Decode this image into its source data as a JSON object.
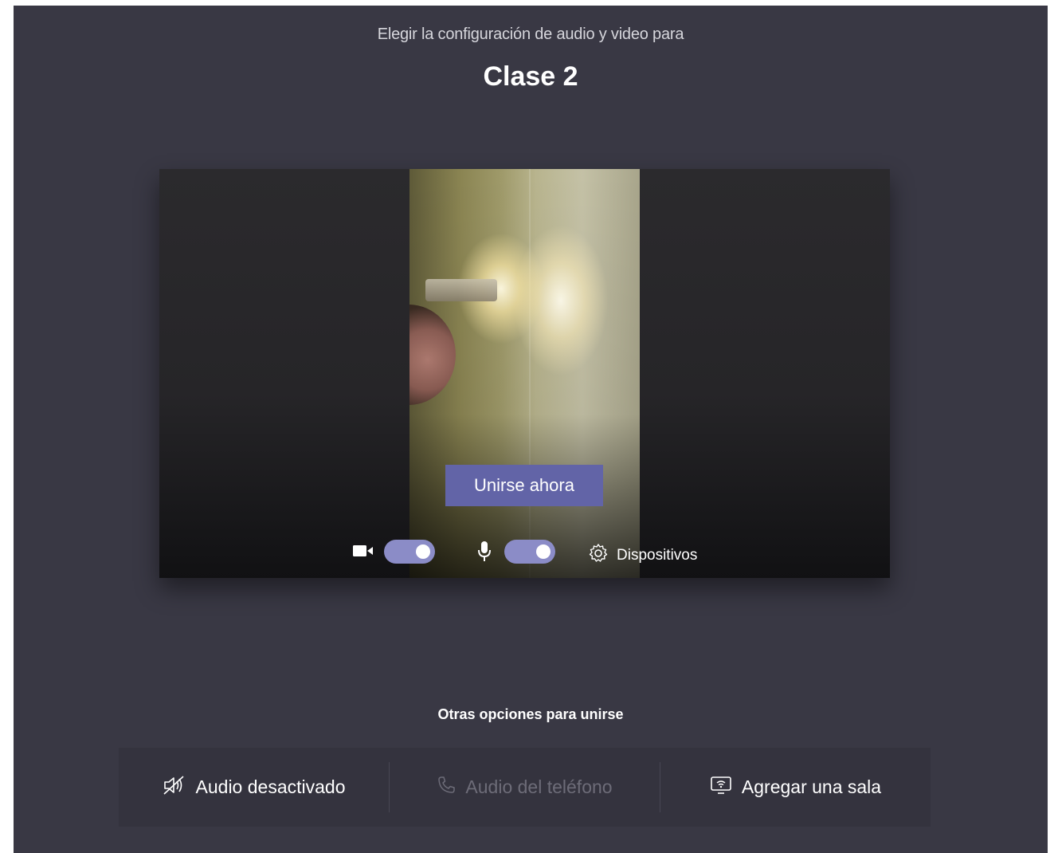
{
  "header": {
    "subtitle": "Elegir la configuración de audio y video para",
    "meeting_title": "Clase 2"
  },
  "preview": {
    "join_button_label": "Unirse ahora",
    "camera_toggle_on": true,
    "mic_toggle_on": true,
    "devices_label": "Dispositivos"
  },
  "other_options": {
    "heading": "Otras opciones para unirse",
    "items": [
      {
        "label": "Audio desactivado",
        "icon": "speaker-off-icon",
        "enabled": true
      },
      {
        "label": "Audio del teléfono",
        "icon": "phone-icon",
        "enabled": false
      },
      {
        "label": "Agregar una sala",
        "icon": "room-icon",
        "enabled": true
      }
    ]
  },
  "colors": {
    "background": "#393844",
    "accent": "#6264a7",
    "toggle_on": "#8b8cc7"
  }
}
